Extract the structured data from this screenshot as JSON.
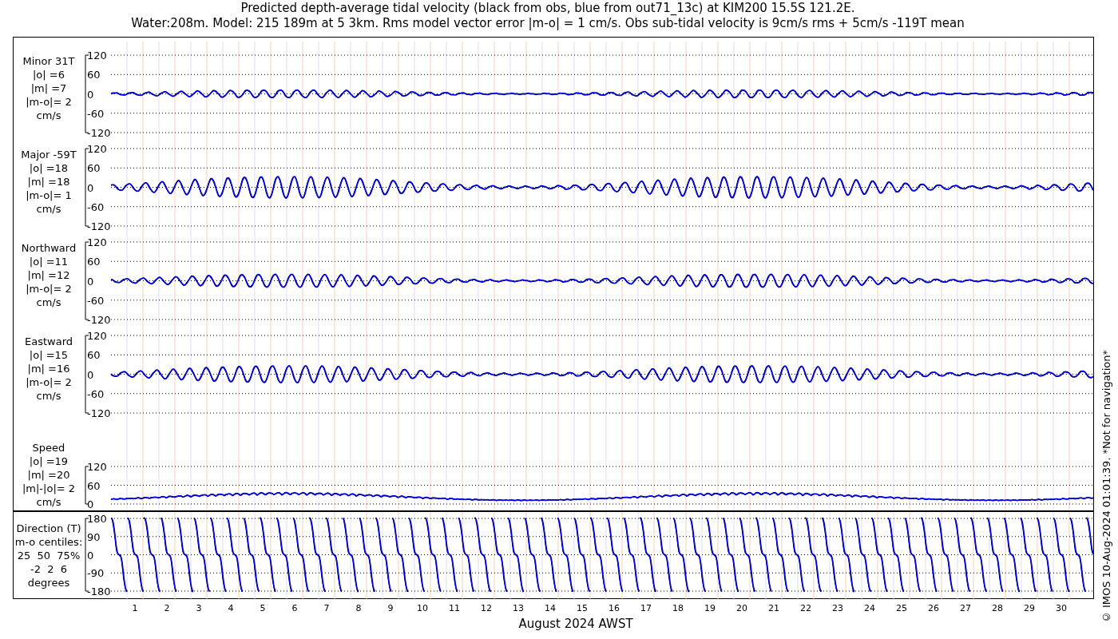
{
  "title_lines": [
    "Predicted depth-average tidal velocity (black from obs, blue from out71_13c) at KIM200 15.5S 121.2E.",
    "Water:208m. Model: 215 189m at 5 3km. Rms model vector error |m-o| = 1 cm/s. Obs sub-tidal velocity is 9cm/s rms + 5cm/s -119T mean"
  ],
  "panels": [
    {
      "kind": "velocity",
      "label_lines": [
        "Minor 31T",
        "|o| =6",
        "|m| =7",
        "|m-o|= 2",
        "cm/s"
      ],
      "yticks": [
        "120",
        "60",
        "0",
        "-60",
        "-120"
      ]
    },
    {
      "kind": "velocity",
      "label_lines": [
        "Major -59T",
        "|o| =18",
        "|m| =18",
        "|m-o|= 1",
        "cm/s"
      ],
      "yticks": [
        "120",
        "60",
        "0",
        "-60",
        "-120"
      ]
    },
    {
      "kind": "velocity",
      "label_lines": [
        "Northward",
        "|o| =11",
        "|m| =12",
        "|m-o|= 2",
        "cm/s"
      ],
      "yticks": [
        "120",
        "60",
        "0",
        "-60",
        "-120"
      ]
    },
    {
      "kind": "velocity",
      "label_lines": [
        "Eastward",
        "|o| =15",
        "|m| =16",
        "|m-o|= 2",
        "cm/s"
      ],
      "yticks": [
        "120",
        "60",
        "0",
        "-60",
        "-120"
      ]
    },
    {
      "kind": "speed",
      "label_lines": [
        "Speed",
        "|o| =19",
        "|m| =20",
        "|m|-|o|= 2",
        "cm/s"
      ],
      "yticks": [
        "120",
        "60",
        "0"
      ]
    },
    {
      "kind": "direction",
      "label_lines": [
        "Direction (T)",
        "m-o centiles:",
        "25  50  75%",
        "-2  2  6",
        "degrees"
      ],
      "yticks": [
        "180",
        "90",
        "0",
        "-90",
        "-180"
      ]
    }
  ],
  "xticks": [
    "1",
    "2",
    "3",
    "4",
    "5",
    "6",
    "7",
    "8",
    "9",
    "10",
    "11",
    "12",
    "13",
    "14",
    "15",
    "16",
    "17",
    "18",
    "19",
    "20",
    "21",
    "22",
    "23",
    "24",
    "25",
    "26",
    "27",
    "28",
    "29",
    "30"
  ],
  "xlabel": "August 2024 AWST",
  "side_note": "© IMOS 10-Aug-2024 01:01:39. *Not for navigation*"
}
